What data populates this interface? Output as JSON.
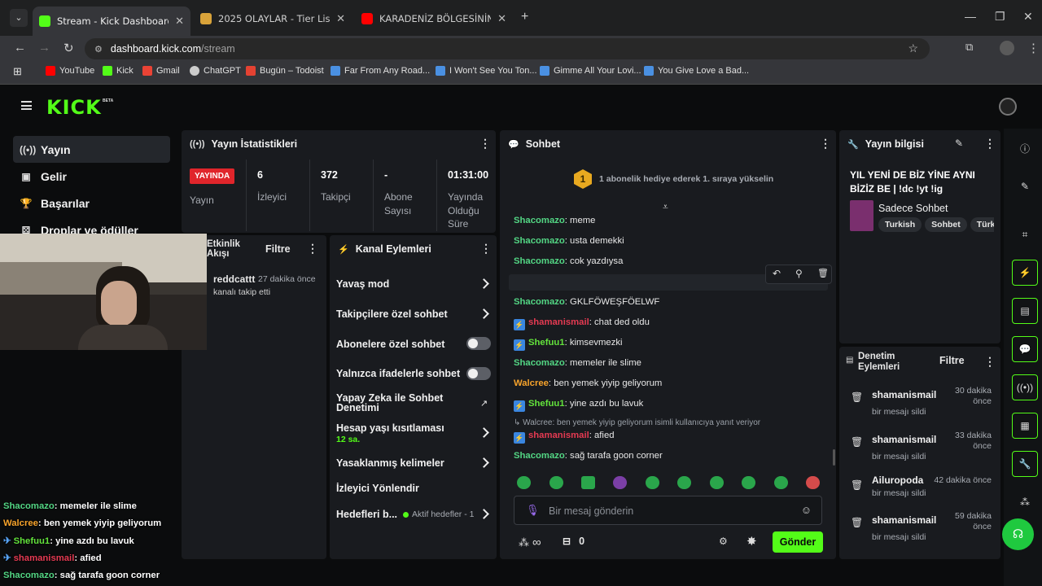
{
  "browser": {
    "tabs": [
      {
        "title": "Stream - Kick Dashboard",
        "active": true,
        "favicon_color": "#53fc18"
      },
      {
        "title": "2025 OLAYLAR - Tier List | Kor S",
        "active": false,
        "favicon_color": "#d9a33a"
      },
      {
        "title": "KARADENİZ BÖLGESİNİN EN Ç",
        "active": false,
        "favicon_color": "#ff0000"
      }
    ],
    "new_tab": "+",
    "url_host": "dashboard.kick.com",
    "url_path": "/stream",
    "bookmarks": [
      {
        "label": "YouTube",
        "color": "#ff0000"
      },
      {
        "label": "Kick",
        "color": "#53fc18"
      },
      {
        "label": "Gmail",
        "color": "#ea4335"
      },
      {
        "label": "ChatGPT",
        "color": "#cccccc"
      },
      {
        "label": "Bugün – Todoist",
        "color": "#e44232"
      },
      {
        "label": "Far From Any Road...",
        "color": "#4a90e2"
      },
      {
        "label": "I Won't See You Ton...",
        "color": "#4a90e2"
      },
      {
        "label": "Gimme All Your Lovi...",
        "color": "#4a90e2"
      },
      {
        "label": "You Give Love a Bad...",
        "color": "#4a90e2"
      }
    ]
  },
  "header": {
    "logo": "KICK",
    "beta": "BETA"
  },
  "sidebar": {
    "items": [
      {
        "label": "Yayın",
        "icon": "broadcast-icon"
      },
      {
        "label": "Gelir",
        "icon": "money-icon"
      },
      {
        "label": "Başarılar",
        "icon": "trophy-icon"
      },
      {
        "label": "Droplar ve ödüller",
        "icon": "gift-icon"
      }
    ]
  },
  "stats": {
    "title": "Yayın İstatistikleri",
    "live_badge": "YAYINDA",
    "live_label": "Yayın",
    "viewers_value": "6",
    "viewers_label": "İzleyici",
    "followers_value": "372",
    "followers_label": "Takipçi",
    "subs_value": "-",
    "subs_label": "Abone Sayısı",
    "duration_value": "01:31:00",
    "duration_label": "Yayında Olduğu Süre"
  },
  "activity": {
    "title_line1": "Etkinlik",
    "title_line2": "Akışı",
    "filter": "Filtre",
    "item_user": "reddcattt",
    "item_time": "27 dakika önce",
    "item_text": "kanalı takip etti"
  },
  "channel_actions": {
    "title": "Kanal Eylemleri",
    "items": {
      "slow": "Yavaş mod",
      "followers": "Takipçilere özel sohbet",
      "subs": "Abonelere özel sohbet",
      "emotes": "Yalnızca ifadelerle sohbet",
      "ai1": "Yapay Zeka ile Sohbet",
      "ai2": "Denetimi",
      "age": "Hesap yaşı kısıtlaması",
      "age_value": "12 sa.",
      "banned": "Yasaklanmış kelimeler",
      "redirect": "İzleyici Yönlendir",
      "goals": "Hedefleri b...",
      "goals_status": "Aktif hedefler - 1"
    }
  },
  "chat": {
    "title": "Sohbet",
    "gift_rank": "1",
    "gift_text": "1 abonelik hediye ederek 1. sıraya yükselin",
    "messages": [
      {
        "user": "Shacomazo",
        "text": "meme",
        "style": "green"
      },
      {
        "user": "Shacomazo",
        "text": "usta demekki",
        "style": "green"
      },
      {
        "user": "Shacomazo",
        "text": "cok yazdıysa",
        "style": "green"
      },
      {
        "user": "Shacomazo",
        "text": "yanlis tonda okudu",
        "style": "green"
      },
      {
        "user": "Shacomazo",
        "text": "GKLFÖWEŞFÖELWF",
        "style": "green"
      },
      {
        "user": "shamanismail",
        "text": "chat ded oldu",
        "style": "red"
      },
      {
        "user": "Shefuu1",
        "text": "kimsevmezki",
        "style": "lime"
      },
      {
        "user": "Shacomazo",
        "text": "memeler ile slime",
        "style": "green"
      },
      {
        "user": "Walcree",
        "text": "ben yemek yiyip geliyorum",
        "style": "orange"
      },
      {
        "user": "Shefuu1",
        "text": "yine azdı bu lavuk",
        "style": "lime"
      },
      {
        "user": "shamanismail",
        "text": "afied",
        "style": "red"
      },
      {
        "user": "Shacomazo",
        "text": "sağ tarafa goon corner",
        "style": "green"
      }
    ],
    "reply_note": "Walcree: ben yemek yiyip geliyorum isimli kullanıcıya yanıt veriyor",
    "input_placeholder": "Bir mesaj gönderin",
    "points_symbol": "∞",
    "gift_count": "0",
    "send_label": "Gönder"
  },
  "stream_info": {
    "title": "Yayın bilgisi",
    "stream_title": "YIL YENİ DE BİZ YİNE AYNI BİZİZ BE | !dc !yt !ig",
    "category": "Sadece Sohbet",
    "tags": [
      "Turkish",
      "Sohbet",
      "Türk"
    ]
  },
  "moderation": {
    "title_line1": "Denetim",
    "title_line2": "Eylemleri",
    "filter": "Filtre",
    "items": [
      {
        "user": "shamanismail",
        "time1": "30 dakika",
        "time2": "önce",
        "action": "bir mesajı sildi"
      },
      {
        "user": "shamanismail",
        "time1": "33 dakika",
        "time2": "önce",
        "action": "bir mesajı sildi"
      },
      {
        "user": "Ailuropoda",
        "time1": "42 dakika önce",
        "time2": "",
        "action": "bir mesajı sildi"
      },
      {
        "user": "shamanismail",
        "time1": "59 dakika",
        "time2": "önce",
        "action": "bir mesajı sildi"
      }
    ]
  },
  "overlay_chat": [
    {
      "user": "Shacomazo",
      "text": "memeler ile slime",
      "style": "green"
    },
    {
      "user": "Walcree",
      "text": "ben yemek yiyip geliyorum",
      "style": "orange"
    },
    {
      "user": "Shefuu1",
      "text": "yine azdı bu lavuk",
      "style": "lime"
    },
    {
      "user": "shamanismail",
      "text": "afied",
      "style": "red"
    },
    {
      "user": "Shacomazo",
      "text": "sağ tarafa goon corner",
      "style": "green"
    }
  ]
}
